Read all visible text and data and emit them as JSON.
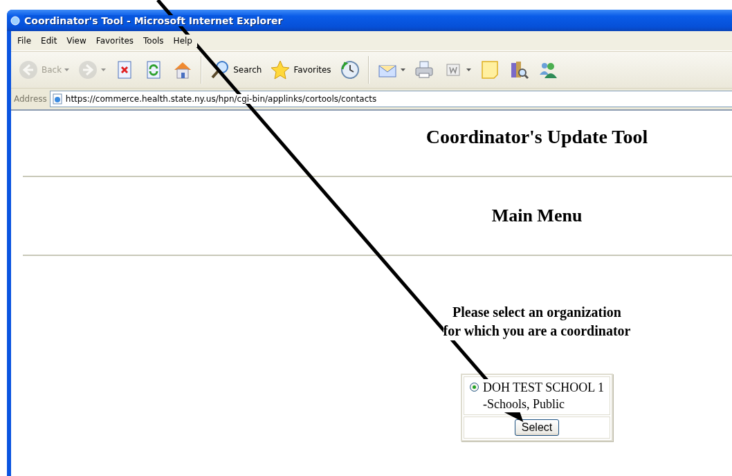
{
  "window": {
    "title": "Coordinator's Tool - Microsoft Internet Explorer"
  },
  "menu": [
    "File",
    "Edit",
    "View",
    "Favorites",
    "Tools",
    "Help"
  ],
  "toolbar": [
    {
      "kind": "back",
      "label": "Back",
      "disabled": true,
      "dropdown": true
    },
    {
      "kind": "forward",
      "disabled": true,
      "dropdown": true
    },
    {
      "kind": "stop",
      "disabled": false,
      "dropdown": false
    },
    {
      "kind": "refresh",
      "disabled": false,
      "dropdown": false
    },
    {
      "kind": "home",
      "disabled": false,
      "dropdown": false
    },
    {
      "kind": "separator"
    },
    {
      "kind": "search",
      "label": "Search",
      "disabled": false,
      "dropdown": false
    },
    {
      "kind": "favorites",
      "label": "Favorites",
      "disabled": false,
      "dropdown": false
    },
    {
      "kind": "history",
      "disabled": false,
      "dropdown": false
    },
    {
      "kind": "separator"
    },
    {
      "kind": "mail",
      "disabled": false,
      "dropdown": true
    },
    {
      "kind": "print",
      "disabled": false,
      "dropdown": false
    },
    {
      "kind": "edit",
      "disabled": false,
      "dropdown": true
    },
    {
      "kind": "note",
      "disabled": false,
      "dropdown": false
    },
    {
      "kind": "research",
      "disabled": false,
      "dropdown": false
    },
    {
      "kind": "messenger",
      "disabled": false,
      "dropdown": false
    }
  ],
  "address": {
    "label": "Address",
    "url": "https://commerce.health.state.ny.us/hpn/cgi-bin/applinks/cortools/contacts"
  },
  "page": {
    "title": "Coordinator's Update Tool",
    "subtitle": "Main Menu",
    "prompt": [
      "Please select an organization",
      "for which you are a coordinator"
    ],
    "organizations": [
      {
        "name": "DOH TEST SCHOOL 1",
        "type": "-Schools, Public",
        "selected": true
      }
    ],
    "button": "Select"
  }
}
